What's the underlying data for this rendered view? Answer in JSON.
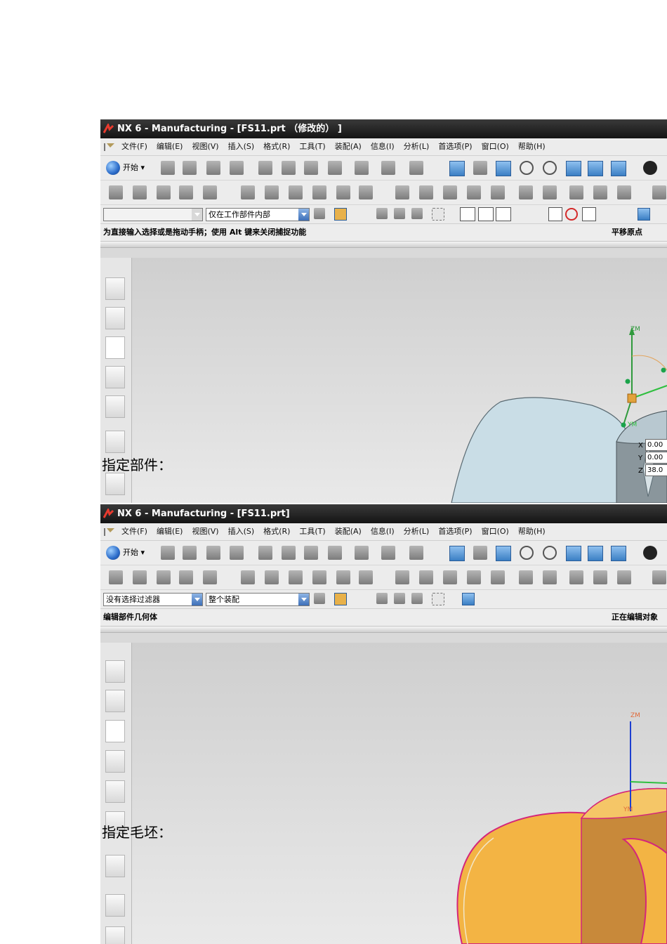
{
  "screenshots": [
    {
      "title": "NX 6 - Manufacturing - [FS11.prt （修改的） ]",
      "menu": [
        "文件(F)",
        "编辑(E)",
        "视图(V)",
        "插入(S)",
        "格式(R)",
        "工具(T)",
        "装配(A)",
        "信息(I)",
        "分析(L)",
        "首选项(P)",
        "窗口(O)",
        "帮助(H)"
      ],
      "start_label": "开始",
      "filter_combo": "",
      "scope_combo": "仅在工作部件内部",
      "status_left": "为直接输入选择或是拖动手柄；使用 Alt 键来关闭捕捉功能",
      "status_right": "平移原点",
      "coords": {
        "x": "0.00",
        "y": "0.00",
        "z": "38.0"
      },
      "axis_labels": {
        "z": "ZM",
        "y": "YM"
      }
    },
    {
      "title": "NX 6 - Manufacturing - [FS11.prt]",
      "menu": [
        "文件(F)",
        "编辑(E)",
        "视图(V)",
        "插入(S)",
        "格式(R)",
        "工具(T)",
        "装配(A)",
        "信息(I)",
        "分析(L)",
        "首选项(P)",
        "窗口(O)",
        "帮助(H)"
      ],
      "start_label": "开始",
      "filter_combo": "没有选择过滤器",
      "scope_combo": "整个装配",
      "status_left": "编辑部件几何体",
      "status_right": "正在编辑对象",
      "axis_labels": {
        "z": "ZM",
        "y": "YM"
      }
    }
  ],
  "captions": {
    "specify_part": "指定部件：",
    "specify_blank": "指定毛坯："
  },
  "colors": {
    "titlebar": "#1e1e1e",
    "part_fill": "#c9dde6",
    "blank_fill": "#f3b444",
    "blank_edge": "#d4267a",
    "axis_z": "#2f9a3c",
    "axis_z2": "#1d3fd0",
    "axis_y": "#2fbf3f"
  }
}
